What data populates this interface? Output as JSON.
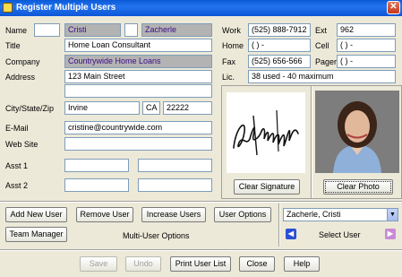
{
  "window": {
    "title": "Register Multiple Users",
    "close_glyph": "✕"
  },
  "labels": {
    "name": "Name",
    "title": "Title",
    "company": "Company",
    "address": "Address",
    "city_state_zip": "City/State/Zip",
    "email": "E-Mail",
    "website": "Web Site",
    "asst1": "Asst 1",
    "asst2": "Asst 2",
    "work": "Work",
    "home": "Home",
    "fax": "Fax",
    "lic": "Lic.",
    "ext": "Ext",
    "cell": "Cell",
    "pager": "Pager"
  },
  "fields": {
    "prefix": "",
    "first_name": "Cristi",
    "middle": "",
    "last_name": "Zacherle",
    "title": "Home Loan Consultant",
    "company": "Countrywide Home Loans",
    "address1": "123 Main Street",
    "address2": "",
    "city": "Irvine",
    "state": "CA",
    "zip": "22222",
    "email": "cristine@countrywide.com",
    "website": "",
    "asst1_a": "",
    "asst1_b": "",
    "asst2_a": "",
    "asst2_b": "",
    "work": "(525) 888-7912",
    "home": "(  )   -",
    "fax": "(525) 656-566",
    "lic": "38 used - 40 maximum",
    "ext": "962",
    "cell": "(  )   -",
    "pager": "(  )   -"
  },
  "photo": {
    "signature_text": "Sue Ellen Bunstead"
  },
  "buttons": {
    "clear_signature": "Clear Signature",
    "clear_photo": "Clear Photo",
    "add_new_user": "Add New User",
    "remove_user": "Remove User",
    "increase_users": "Increase Users",
    "user_options": "User Options",
    "team_manager": "Team Manager",
    "save": "Save",
    "undo": "Undo",
    "print_user_list": "Print User List",
    "close": "Close",
    "help": "Help"
  },
  "multi_user_options_label": "Multi-User Options",
  "select_user": {
    "value": "Zacherle, Cristi",
    "label": "Select User"
  },
  "icons": {
    "prev": "arrow-left-icon",
    "next": "arrow-right-icon",
    "app": "register-users-app-icon",
    "dropdown": "chevron-down-icon"
  },
  "colors": {
    "selected_field": "#b3b3b3",
    "selected_text": "#3b0c86",
    "titlebar": "#0a5ad8"
  }
}
